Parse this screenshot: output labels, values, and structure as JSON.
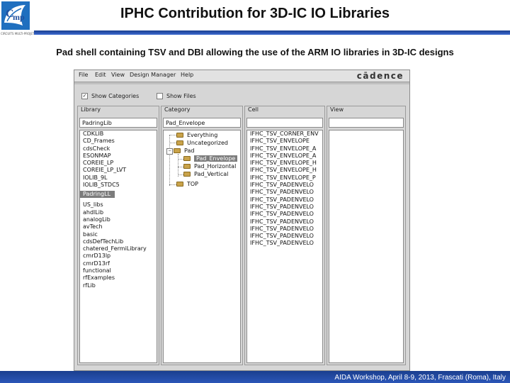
{
  "slide": {
    "title": "IPHC Contribution for 3D-IC IO Libraries",
    "subtitle": "Pad shell containing TSV and DBI allowing the use of the ARM IO libraries in 3D-IC designs",
    "footer": "AIDA Workshop, April 8-9, 2013, Frascati (Roma), Italy"
  },
  "app": {
    "menus": [
      "File",
      "Edit",
      "View",
      "Design Manager",
      "Help"
    ],
    "brand": "cādence",
    "show_categories": {
      "label": "Show Categories",
      "checked": true
    },
    "show_files": {
      "label": "Show Files",
      "checked": false
    },
    "library": {
      "header": "Library",
      "value": "PadringLib",
      "items": [
        "CDKLIB",
        "CD_Frames",
        "cdsCheck",
        "ESONMAP",
        "COREIE_LP",
        "COREIE_LP_LVT",
        "IOLIB_9L",
        "IOLIB_STDC5",
        "PadringLL",
        "US_libs",
        "ahdlLib",
        "analogLib",
        "avTech",
        "basic",
        "cdsDefTechLib",
        "chatered_FermiLibrary",
        "cmrD13lp",
        "cmrD13rf",
        "functional",
        "rfExamples",
        "rfLib"
      ],
      "selected_index": 8
    },
    "category": {
      "header": "Category",
      "value": "Pad_Envelope",
      "items": [
        "Everything",
        "Uncategorized",
        "Pad",
        "Pad_Envelope",
        "Pad_Horizontal",
        "Pad_Vertical",
        "TOP"
      ],
      "selected": "Pad_Envelope"
    },
    "cell": {
      "header": "Cell",
      "value": "",
      "items": [
        "IFHC_TSV_CORNER_ENV",
        "IFHC_TSV_ENVELOPE",
        "IFHC_TSV_ENVELOPE_A",
        "IFHC_TSV_ENVELOPE_A",
        "IFHC_TSV_ENVELOPE_H",
        "IFHC_TSV_ENVELOPE_H",
        "IFHC_TSV_ENVELOPE_P",
        "IFHC_TSV_PADENVELO",
        "IFHC_TSV_PADENVELO",
        "IFHC_TSV_PADENVELO",
        "IFHC_TSV_PADENVELO",
        "IFHC_TSV_PADENVELO",
        "IFHC_TSV_PADENVELO",
        "IFHC_TSV_PADENVELO",
        "IFHC_TSV_PADENVELO",
        "IFHC_TSV_PADENVELO"
      ]
    },
    "view": {
      "header": "View",
      "value": ""
    }
  }
}
